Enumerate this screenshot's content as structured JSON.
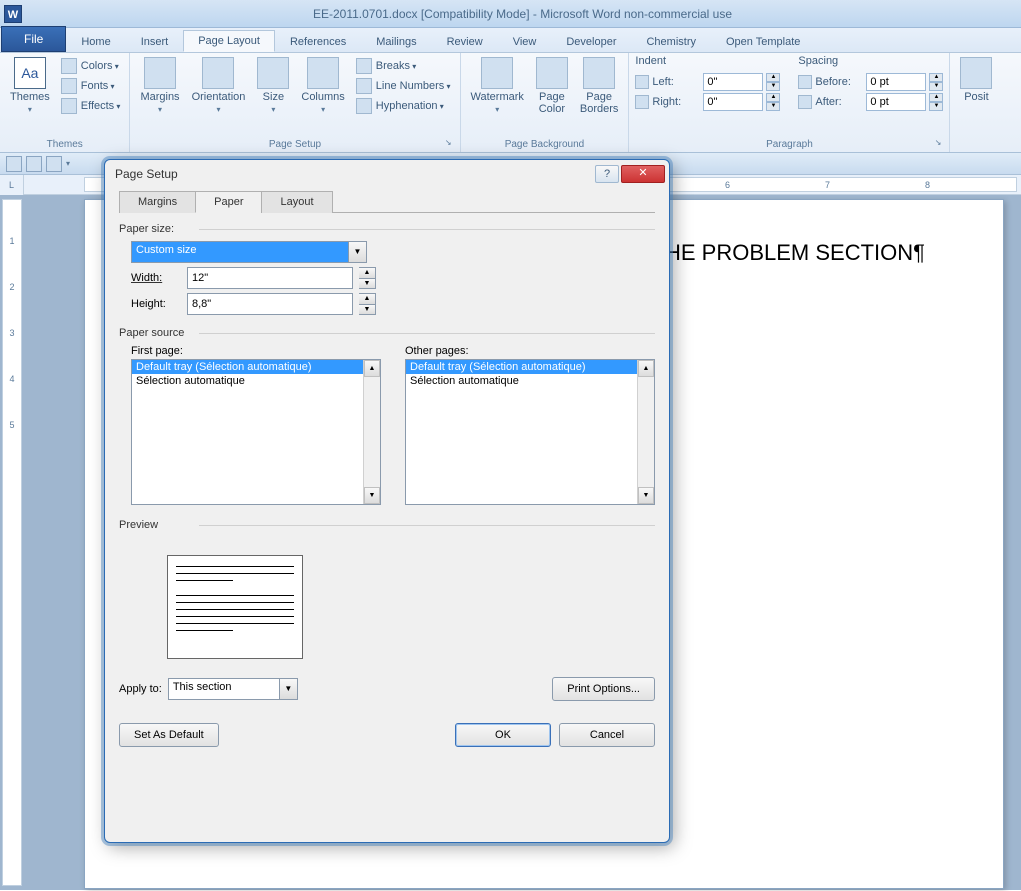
{
  "titlebar": {
    "title": "EE-2011.0701.docx [Compatibility Mode] - Microsoft Word non-commercial use"
  },
  "tabs": {
    "file": "File",
    "list": [
      "Home",
      "Insert",
      "Page Layout",
      "References",
      "Mailings",
      "Review",
      "View",
      "Developer",
      "Chemistry",
      "Open Template"
    ],
    "active_index": 2
  },
  "ribbon": {
    "themes": {
      "label": "Themes",
      "btn": "Themes",
      "colors": "Colors",
      "fonts": "Fonts",
      "effects": "Effects"
    },
    "page_setup": {
      "label": "Page Setup",
      "margins": "Margins",
      "orientation": "Orientation",
      "size": "Size",
      "columns": "Columns",
      "breaks": "Breaks",
      "line_numbers": "Line Numbers",
      "hyphenation": "Hyphenation"
    },
    "page_background": {
      "label": "Page Background",
      "watermark": "Watermark",
      "page_color": "Page\nColor",
      "page_borders": "Page\nBorders"
    },
    "paragraph": {
      "label": "Paragraph",
      "indent_label": "Indent",
      "left_label": "Left:",
      "left_val": "0\"",
      "right_label": "Right:",
      "right_val": "0\"",
      "spacing_label": "Spacing",
      "before_label": "Before:",
      "before_val": "0 pt",
      "after_label": "After:",
      "after_val": "0 pt"
    },
    "arrange": {
      "position": "Posit"
    }
  },
  "document": {
    "visible_text": "HE PROBLEM SECTION¶"
  },
  "dialog": {
    "title": "Page Setup",
    "tabs": [
      "Margins",
      "Paper",
      "Layout"
    ],
    "active_tab": 1,
    "paper_size_label": "Paper size:",
    "paper_size_value": "Custom size",
    "width_label": "Width:",
    "width_value": "12\"",
    "height_label": "Height:",
    "height_value": "8,8\"",
    "paper_source_label": "Paper source",
    "first_page_label": "First page:",
    "other_pages_label": "Other pages:",
    "tray_options": [
      "Default tray (Sélection automatique)",
      "Sélection automatique"
    ],
    "preview_label": "Preview",
    "apply_to_label": "Apply to:",
    "apply_to_value": "This section",
    "print_options": "Print Options...",
    "set_default": "Set As Default",
    "ok": "OK",
    "cancel": "Cancel"
  },
  "ruler": {
    "h_marks": [
      "6",
      "7",
      "8"
    ],
    "corner": "L"
  }
}
